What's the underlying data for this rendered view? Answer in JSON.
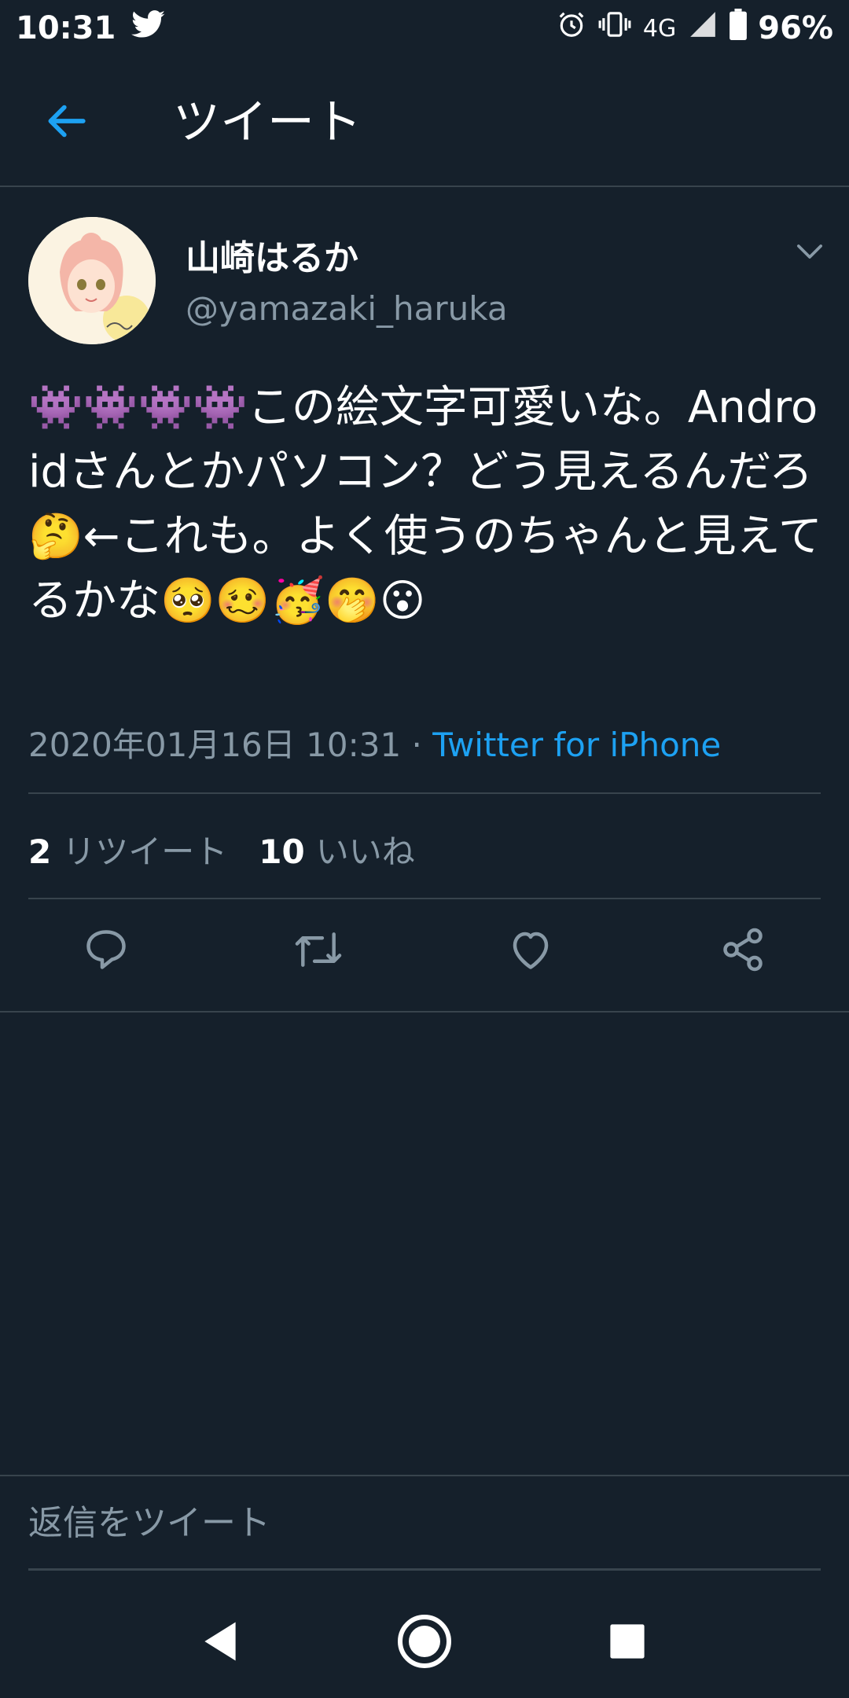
{
  "status_bar": {
    "time": "10:31",
    "network": "4G",
    "battery": "96%",
    "icons": [
      "twitter-icon",
      "alarm-icon",
      "vibrate-icon",
      "signal-icon",
      "battery-icon"
    ]
  },
  "header": {
    "title": "ツイート",
    "back_icon": "back-arrow-icon"
  },
  "tweet": {
    "display_name": "山崎はるか",
    "handle": "@yamazaki_haruka",
    "text": "👾👾👾👾この絵文字可愛いな。Androidさんとかパソコン？どう見えるんだろ🤔←これも。よく使うのちゃんと見えてるかな🥺🥴🥳🤭😮",
    "timestamp": "2020年01月16日 10:31",
    "separator": " · ",
    "source": "Twitter for iPhone",
    "retweets_count": "2",
    "retweets_label": "リツイート",
    "likes_count": "10",
    "likes_label": "いいね"
  },
  "actions": [
    "reply-icon",
    "retweet-icon",
    "like-icon",
    "share-icon"
  ],
  "reply_bar": {
    "placeholder": "返信をツイート"
  },
  "nav": [
    "back-nav-icon",
    "home-nav-icon",
    "recents-nav-icon"
  ],
  "colors": {
    "background": "#15202b",
    "accent": "#1da1f2",
    "secondary_text": "#8899a6",
    "divider": "#38444d"
  }
}
